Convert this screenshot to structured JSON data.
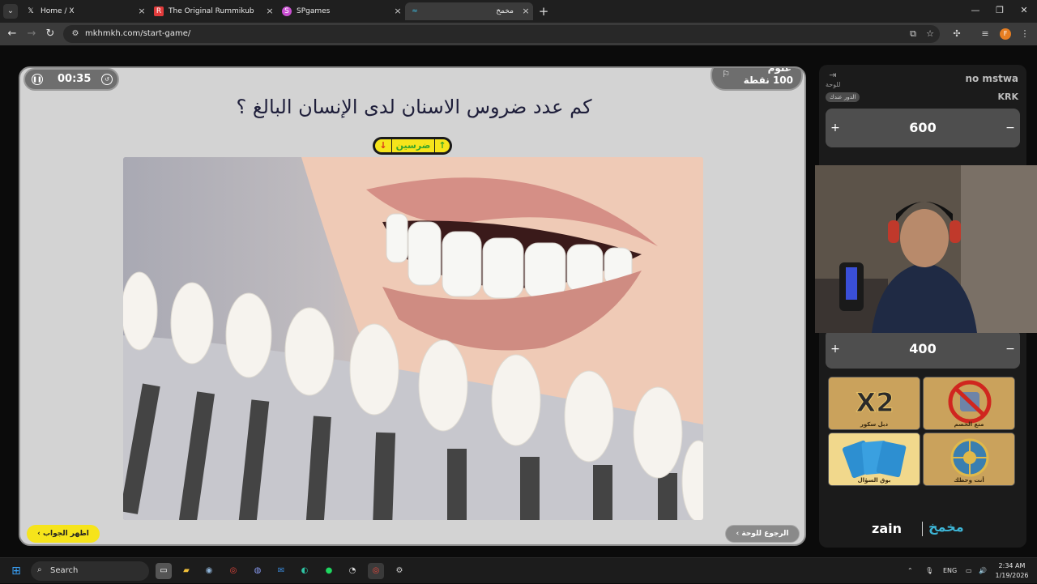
{
  "browser": {
    "tabs": [
      {
        "title": "Home / X",
        "icon": "x-icon"
      },
      {
        "title": "The Original Rummikub",
        "icon": "rummikub-icon"
      },
      {
        "title": "SPgames",
        "icon": "spgames-icon"
      },
      {
        "title": "مخمخ",
        "icon": "mkhmkh-icon",
        "active": true
      }
    ],
    "url": "mkhmkh.com/start-game/"
  },
  "game": {
    "timer": "00:35",
    "category": {
      "name": "علوم",
      "points": "100 نقطة"
    },
    "question": "كم عدد ضروس الاسنان لدى الإنسان البالغ ؟",
    "powerup_label": "ضرسين",
    "show_answer_label": "اظهر الجواب",
    "back_to_board_label": "الرجوع للوحة"
  },
  "sidebar": {
    "exit_label": "للوحة",
    "team1": {
      "name": "no mstwa",
      "score": "600"
    },
    "turn_badge": "الدور عندك",
    "team2": {
      "name": "KRK",
      "score": "400"
    },
    "helpers": [
      {
        "caption": "دبل سكور",
        "icon": "x2-icon"
      },
      {
        "caption": "منع الخصم",
        "icon": "block-opponent-icon"
      },
      {
        "caption": "بوق السؤال",
        "icon": "cards-icon"
      },
      {
        "caption": "أنت وحظك",
        "icon": "wheel-icon"
      }
    ],
    "brand_zain": "zain",
    "brand_logo": "مخمخ"
  },
  "taskbar": {
    "search_label": "Search",
    "lang": "ENG",
    "time": "2:34 AM",
    "date": "1/19/2026"
  }
}
